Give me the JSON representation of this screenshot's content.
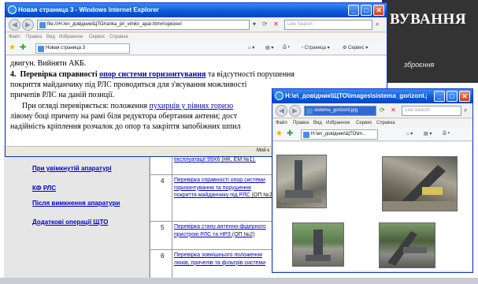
{
  "background_page": {
    "header_title": "ВУВАННЯ",
    "header_subtitle": "зброєння",
    "nav_links": [
      "При увімкнутій апаратурі",
      "КФ РЛС",
      "Після вимкнення апаратури",
      "Додаткові операції ЩТО"
    ],
    "table_rows": [
      {
        "num": "",
        "link": "експлуатації 99Х6",
        "rest": " (НК, ЕМ №1)."
      },
      {
        "num": "4",
        "link": "Перевірка справності опор системи горизонтування та порушення покриття майданчику під РЛС",
        "rest": " (ОП №2)"
      },
      {
        "num": "5",
        "link": "Перевірка стану антенно-фідерного пристрою РЛС та НРЗ",
        "rest": " (ОП №2)"
      },
      {
        "num": "6",
        "link": "Перевірка зовнішнього положення люків, причепів та фільтрів системи",
        "rest": ""
      }
    ]
  },
  "main_window": {
    "title": "Новая страница 3 - Windows Internet Explorer",
    "address": "file:///H:/en_довідник/ЩТО/ranka_pri_vimkn_apar.htm#горизонт",
    "search_placeholder": "Live Search",
    "menu": [
      "Файл",
      "Правка",
      "Вид",
      "Избранное",
      "Сервис",
      "Справка"
    ],
    "tab_label": "Новая страница 3",
    "cmd_page": "Страница",
    "cmd_service": "Сервис",
    "doc": {
      "line0": "двигун. Вийняти АКБ.",
      "h_num": "4.",
      "h_text1": "Перевірка справності ",
      "h_link": "опор системи горизонтування",
      "h_text2": " та відсутності порушення",
      "line2": "покриття майданчику під РЛС проводиться для з'ясування можливості",
      "line3": "причепів РЛС на даній позиції.",
      "line4a": "При огляді перевіряється: положення ",
      "line4_link": "пухирців у рівнях горизо",
      "line5": "лівому боці причепу на рамі біля редуктора обертання антени; дост",
      "line6": "надійність кріплення розчалок до опор та закріптя запобіжних шпил"
    },
    "status_text": "Мой к"
  },
  "image_window": {
    "title": "H:\\e\\_довідник\\ЩТО\\images\\sistema_gorizont.jp...",
    "address": "sistema_gorizont.jpg",
    "search_placeholder": "Live Search",
    "menu": [
      "Файл",
      "Правка",
      "Вид",
      "Избранное",
      "Сервис",
      "Справка"
    ],
    "tab_label": "H:\\en_довідник\\ЩТО\\im..."
  }
}
